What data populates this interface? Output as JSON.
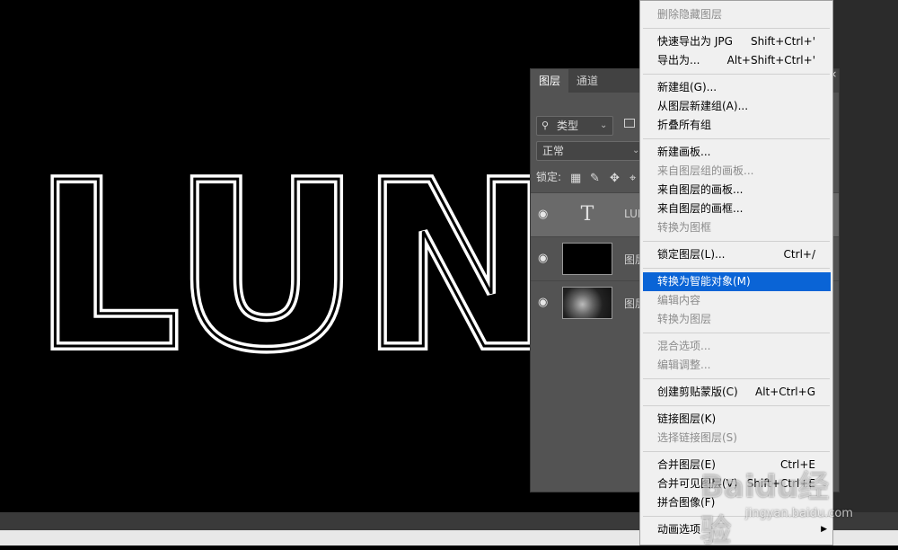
{
  "canvas": {
    "art_text": "LUNG"
  },
  "layers_panel": {
    "tabs": [
      {
        "label": "图层",
        "active": true
      },
      {
        "label": "通道",
        "active": false
      }
    ],
    "filter": {
      "label": "类型"
    },
    "blend_mode": "正常",
    "lock_label": "锁定:",
    "layers": [
      {
        "name": "LUN",
        "type": "text",
        "thumb_glyph": "T",
        "selected": true
      },
      {
        "name": "图层",
        "type": "fill-black",
        "selected": false
      },
      {
        "name": "图层",
        "type": "clouds",
        "selected": false
      }
    ],
    "close_glyph": "×"
  },
  "context_menu": {
    "items": [
      {
        "label": "删除隐藏图层",
        "shortcut": "",
        "disabled": true
      },
      {
        "sep": true
      },
      {
        "label": "快速导出为 JPG",
        "shortcut": "Shift+Ctrl+'",
        "disabled": false
      },
      {
        "label": "导出为...",
        "shortcut": "Alt+Shift+Ctrl+'",
        "disabled": false
      },
      {
        "sep": true
      },
      {
        "label": "新建组(G)...",
        "shortcut": "",
        "disabled": false
      },
      {
        "label": "从图层新建组(A)...",
        "shortcut": "",
        "disabled": false
      },
      {
        "label": "折叠所有组",
        "shortcut": "",
        "disabled": false
      },
      {
        "sep": true
      },
      {
        "label": "新建画板...",
        "shortcut": "",
        "disabled": false
      },
      {
        "label": "来自图层组的画板...",
        "shortcut": "",
        "disabled": true
      },
      {
        "label": "来自图层的画板...",
        "shortcut": "",
        "disabled": false
      },
      {
        "label": "来自图层的画框...",
        "shortcut": "",
        "disabled": false
      },
      {
        "label": "转换为图框",
        "shortcut": "",
        "disabled": true
      },
      {
        "sep": true
      },
      {
        "label": "锁定图层(L)...",
        "shortcut": "Ctrl+/",
        "disabled": false
      },
      {
        "sep": true
      },
      {
        "label": "转换为智能对象(M)",
        "shortcut": "",
        "disabled": false,
        "highlighted": true
      },
      {
        "label": "编辑内容",
        "shortcut": "",
        "disabled": true
      },
      {
        "label": "转换为图层",
        "shortcut": "",
        "disabled": true
      },
      {
        "sep": true
      },
      {
        "label": "混合选项...",
        "shortcut": "",
        "disabled": true
      },
      {
        "label": "编辑调整...",
        "shortcut": "",
        "disabled": true
      },
      {
        "sep": true
      },
      {
        "label": "创建剪贴蒙版(C)",
        "shortcut": "Alt+Ctrl+G",
        "disabled": false
      },
      {
        "sep": true
      },
      {
        "label": "链接图层(K)",
        "shortcut": "",
        "disabled": false
      },
      {
        "label": "选择链接图层(S)",
        "shortcut": "",
        "disabled": true
      },
      {
        "sep": true
      },
      {
        "label": "合并图层(E)",
        "shortcut": "Ctrl+E",
        "disabled": false
      },
      {
        "label": "合并可见图层(V)",
        "shortcut": "Shift+Ctrl+E",
        "disabled": false
      },
      {
        "label": "拼合图像(F)",
        "shortcut": "",
        "disabled": false
      },
      {
        "sep": true
      },
      {
        "label": "动画选项",
        "shortcut": "",
        "disabled": false,
        "submenu": true
      }
    ]
  },
  "watermark": {
    "logo": "Baidu经验",
    "url": "jingyan.baidu.com"
  }
}
